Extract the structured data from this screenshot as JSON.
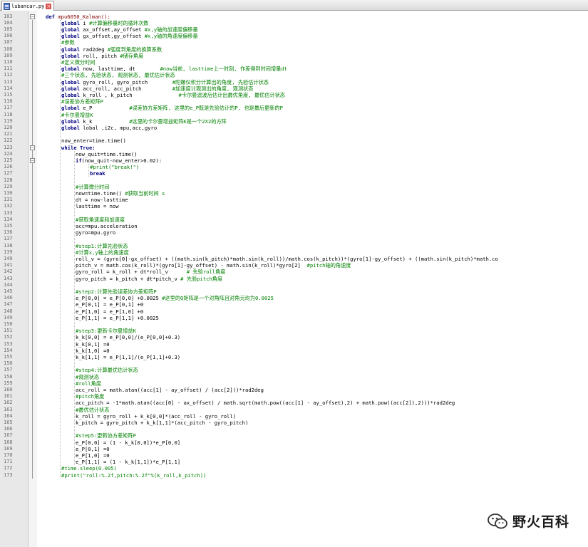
{
  "tab": {
    "label": "lubancar.py",
    "close_glyph": "×"
  },
  "watermark": {
    "text": "野火百科"
  },
  "lines": [
    {
      "n": "103",
      "ind": 0,
      "t": "def mpu6050_Kalman():",
      "s": "def"
    },
    {
      "n": "104",
      "ind": 1,
      "t": "global i #计算偏移量时的循环次数",
      "s": "g"
    },
    {
      "n": "105",
      "ind": 1,
      "t": "global ax_offset,ay_offset #x,y轴的加速度偏移量",
      "s": "g"
    },
    {
      "n": "106",
      "ind": 1,
      "t": "global gx_offset,gy_offset #x,y轴的角速度偏移量",
      "s": "g"
    },
    {
      "n": "107",
      "ind": 1,
      "t": "#参数",
      "s": "c"
    },
    {
      "n": "108",
      "ind": 1,
      "t": "global rad2deg #弧度到角度的换算系数",
      "s": "g"
    },
    {
      "n": "109",
      "ind": 1,
      "t": "global roll, pitch #储存角度",
      "s": "g"
    },
    {
      "n": "110",
      "ind": 1,
      "t": "#定义微分时间",
      "s": "c"
    },
    {
      "n": "111",
      "ind": 1,
      "t": "global now, lasttime, dt        #now当前, lasttime上一时刻, 作差得到时间增量dt",
      "s": "g"
    },
    {
      "n": "112",
      "ind": 1,
      "t": "#三个状态, 先验状态, 观测状态, 最优估计状态",
      "s": "c"
    },
    {
      "n": "113",
      "ind": 1,
      "t": "global gyro_roll, gyro_pitch        #陀螺仪积分计算出的角度, 先验估计状态",
      "s": "g"
    },
    {
      "n": "114",
      "ind": 1,
      "t": "global acc_roll, acc_pitch          #加速度计观测出的角度, 观测状态",
      "s": "g"
    },
    {
      "n": "115",
      "ind": 1,
      "t": "global k_roll , k_pitch               #卡尔曼滤波后估计出最优角度, 最优估计状态",
      "s": "g"
    },
    {
      "n": "116",
      "ind": 1,
      "t": "#误差协方差矩阵P",
      "s": "c"
    },
    {
      "n": "117",
      "ind": 1,
      "t": "global e_P            #误差协方差矩阵, 这里的e_P既是先验估计的P, 也是最后更新的P",
      "s": "g"
    },
    {
      "n": "118",
      "ind": 1,
      "t": "#卡尔曼增益K",
      "s": "c"
    },
    {
      "n": "119",
      "ind": 1,
      "t": "global k_k            #这里的卡尔曼增益矩阵K是一个2X2的方阵",
      "s": "g"
    },
    {
      "n": "120",
      "ind": 1,
      "t": "global lobal ,i2c, mpu,acc,gyro",
      "s": "g"
    },
    {
      "n": "121",
      "ind": 0,
      "t": "",
      "s": "n"
    },
    {
      "n": "122",
      "ind": 1,
      "t": "now_enter=time.time()",
      "s": "n"
    },
    {
      "n": "123",
      "ind": 1,
      "t": "while True:",
      "s": "k"
    },
    {
      "n": "124",
      "ind": 2,
      "t": "now_quit=time.time()",
      "s": "n"
    },
    {
      "n": "125",
      "ind": 2,
      "t": "if(now_quit-now_enter>0.02):",
      "s": "if"
    },
    {
      "n": "126",
      "ind": 3,
      "t": "#print(\"break!\")",
      "s": "c"
    },
    {
      "n": "127",
      "ind": 3,
      "t": "break",
      "s": "k"
    },
    {
      "n": "128",
      "ind": 0,
      "t": "",
      "s": "n"
    },
    {
      "n": "129",
      "ind": 2,
      "t": "#计算微分时间",
      "s": "c"
    },
    {
      "n": "130",
      "ind": 2,
      "t": "now=time.time() #获取当前时间 s",
      "s": "n"
    },
    {
      "n": "131",
      "ind": 2,
      "t": "dt = now-lasttime",
      "s": "n"
    },
    {
      "n": "132",
      "ind": 2,
      "t": "lasttime = now",
      "s": "n"
    },
    {
      "n": "133",
      "ind": 0,
      "t": "",
      "s": "n"
    },
    {
      "n": "134",
      "ind": 2,
      "t": "#获取角速度和加速度",
      "s": "c"
    },
    {
      "n": "135",
      "ind": 2,
      "t": "acc=mpu.acceleration",
      "s": "n"
    },
    {
      "n": "136",
      "ind": 2,
      "t": "gyro=mpu.gyro",
      "s": "n"
    },
    {
      "n": "137",
      "ind": 0,
      "t": "",
      "s": "n"
    },
    {
      "n": "138",
      "ind": 2,
      "t": "#step1:计算先验状态",
      "s": "c"
    },
    {
      "n": "139",
      "ind": 2,
      "t": "#计算x,y轴上的角速度",
      "s": "c"
    },
    {
      "n": "140",
      "ind": 2,
      "t": "roll_v = (gyro[0]-gx_offset) + ((math.sin(k_pitch)*math.sin(k_roll))/math.cos(k_pitch))*(gyro[1]-gy_offset) + ((math.sin(k_pitch)*math.co",
      "s": "n"
    },
    {
      "n": "141",
      "ind": 2,
      "t": "pitch_v = math.cos(k_roll)*(gyro[1]-gy_offset) - math.sin(k_roll)*gyro[2]  #pitch轴的角速度",
      "s": "n"
    },
    {
      "n": "142",
      "ind": 2,
      "t": "gyro_roll = k_roll + dt*roll_v      # 先验roll角度",
      "s": "n"
    },
    {
      "n": "143",
      "ind": 2,
      "t": "gyro_pitch = k_pitch + dt*pitch_v # 先验pitch角度",
      "s": "n"
    },
    {
      "n": "144",
      "ind": 0,
      "t": "",
      "s": "n"
    },
    {
      "n": "145",
      "ind": 2,
      "t": "#step2:计算先验误差协方差矩阵P",
      "s": "c"
    },
    {
      "n": "146",
      "ind": 2,
      "t": "e_P[0,0] = e_P[0,0] +0.0025 #这里的Q矩阵是一个对角阵且对角元均为0.0025",
      "s": "n"
    },
    {
      "n": "147",
      "ind": 2,
      "t": "e_P[0,1] = e_P[0,1] +0",
      "s": "n"
    },
    {
      "n": "148",
      "ind": 2,
      "t": "e_P[1,0] = e_P[1,0] +0",
      "s": "n"
    },
    {
      "n": "149",
      "ind": 2,
      "t": "e_P[1,1] = e_P[1,1] +0.0025",
      "s": "n"
    },
    {
      "n": "150",
      "ind": 0,
      "t": "",
      "s": "n"
    },
    {
      "n": "151",
      "ind": 2,
      "t": "#step3:更新卡尔曼增益K",
      "s": "c"
    },
    {
      "n": "152",
      "ind": 2,
      "t": "k_k[0,0] = e_P[0,0]/(e_P[0,0]+0.3)",
      "s": "n"
    },
    {
      "n": "153",
      "ind": 2,
      "t": "k_k[0,1] =0",
      "s": "n"
    },
    {
      "n": "154",
      "ind": 2,
      "t": "k_k[1,0] =0",
      "s": "n"
    },
    {
      "n": "155",
      "ind": 2,
      "t": "k_k[1,1] = e_P[1,1]/(e_P[1,1]+0.3)",
      "s": "n"
    },
    {
      "n": "156",
      "ind": 0,
      "t": "",
      "s": "n"
    },
    {
      "n": "157",
      "ind": 2,
      "t": "#step4:计算最优估计状态",
      "s": "c"
    },
    {
      "n": "158",
      "ind": 2,
      "t": "#观测状态",
      "s": "c"
    },
    {
      "n": "159",
      "ind": 2,
      "t": "#roll角度",
      "s": "c"
    },
    {
      "n": "160",
      "ind": 2,
      "t": "acc_roll = math.atan((acc[1] - ay_offset) / (acc[2]))*rad2deg",
      "s": "n"
    },
    {
      "n": "161",
      "ind": 2,
      "t": "#pitch角度",
      "s": "c"
    },
    {
      "n": "162",
      "ind": 2,
      "t": "acc_pitch = -1*math.atan((acc[0] - ax_offset) / math.sqrt(math.pow((acc[1] - ay_offset),2) + math.pow((acc[2]),2)))*rad2deg",
      "s": "n"
    },
    {
      "n": "163",
      "ind": 2,
      "t": "#最优估计状态",
      "s": "c"
    },
    {
      "n": "164",
      "ind": 2,
      "t": "k_roll = gyro_roll + k_k[0,0]*(acc_roll - gyro_roll)",
      "s": "n"
    },
    {
      "n": "165",
      "ind": 2,
      "t": "k_pitch = gyro_pitch + k_k[1,1]*(acc_pitch - gyro_pitch)",
      "s": "n"
    },
    {
      "n": "166",
      "ind": 0,
      "t": "",
      "s": "n"
    },
    {
      "n": "167",
      "ind": 2,
      "t": "#step5:更新协方差矩阵P",
      "s": "c"
    },
    {
      "n": "168",
      "ind": 2,
      "t": "e_P[0,0] = (1 - k_k[0,0])*e_P[0,0]",
      "s": "n"
    },
    {
      "n": "169",
      "ind": 2,
      "t": "e_P[0,1] =0",
      "s": "n"
    },
    {
      "n": "170",
      "ind": 2,
      "t": "e_P[1,0] =0",
      "s": "n"
    },
    {
      "n": "171",
      "ind": 2,
      "t": "e_P[1,1] = (1 - k_k[1,1])*e_P[1,1]",
      "s": "n"
    },
    {
      "n": "172",
      "ind": 1,
      "t": "#time.sleep(0.005)",
      "s": "c"
    },
    {
      "n": "173",
      "ind": 1,
      "t": "#print(\"roll:%.2f,pitch:%.2f\"%(k_roll,k_pitch))",
      "s": "c"
    }
  ]
}
